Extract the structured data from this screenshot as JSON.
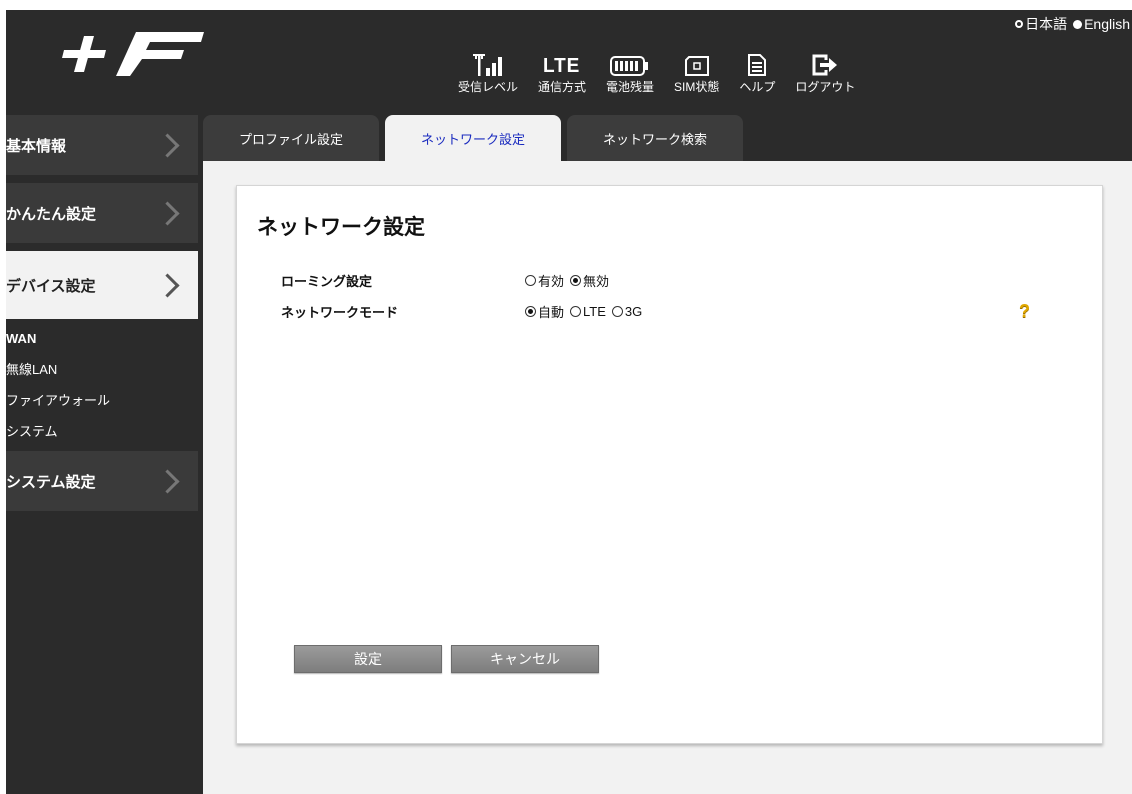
{
  "lang": {
    "japanese": "日本語",
    "english": "English"
  },
  "status": {
    "signal": "受信レベル",
    "network_type_icon": "LTE",
    "network_type": "通信方式",
    "battery": "電池残量",
    "sim": "SIM状態",
    "help": "ヘルプ",
    "logout": "ログアウト"
  },
  "sidebar": {
    "basic": "基本情報",
    "easy": "かんたん設定",
    "device": "デバイス設定",
    "sub": [
      "WAN",
      "無線LAN",
      "ファイアウォール",
      "システム"
    ],
    "system": "システム設定"
  },
  "tabs": [
    "プロファイル設定",
    "ネットワーク設定",
    "ネットワーク検索"
  ],
  "panel": {
    "title": "ネットワーク設定",
    "roaming_label": "ローミング設定",
    "roaming_on": "有効",
    "roaming_off": "無効",
    "mode_label": "ネットワークモード",
    "mode_auto": "自動",
    "mode_lte": "LTE",
    "mode_3g": "3G",
    "help_mark": "?",
    "apply": "設定",
    "cancel": "キャンセル"
  },
  "selected": {
    "roaming": "無効",
    "mode": "自動",
    "lang": "English"
  },
  "colors": {
    "active_tab_text": "#1a2bbf",
    "help_icon": "#e0a800",
    "header_bg": "#2b2b2b"
  }
}
